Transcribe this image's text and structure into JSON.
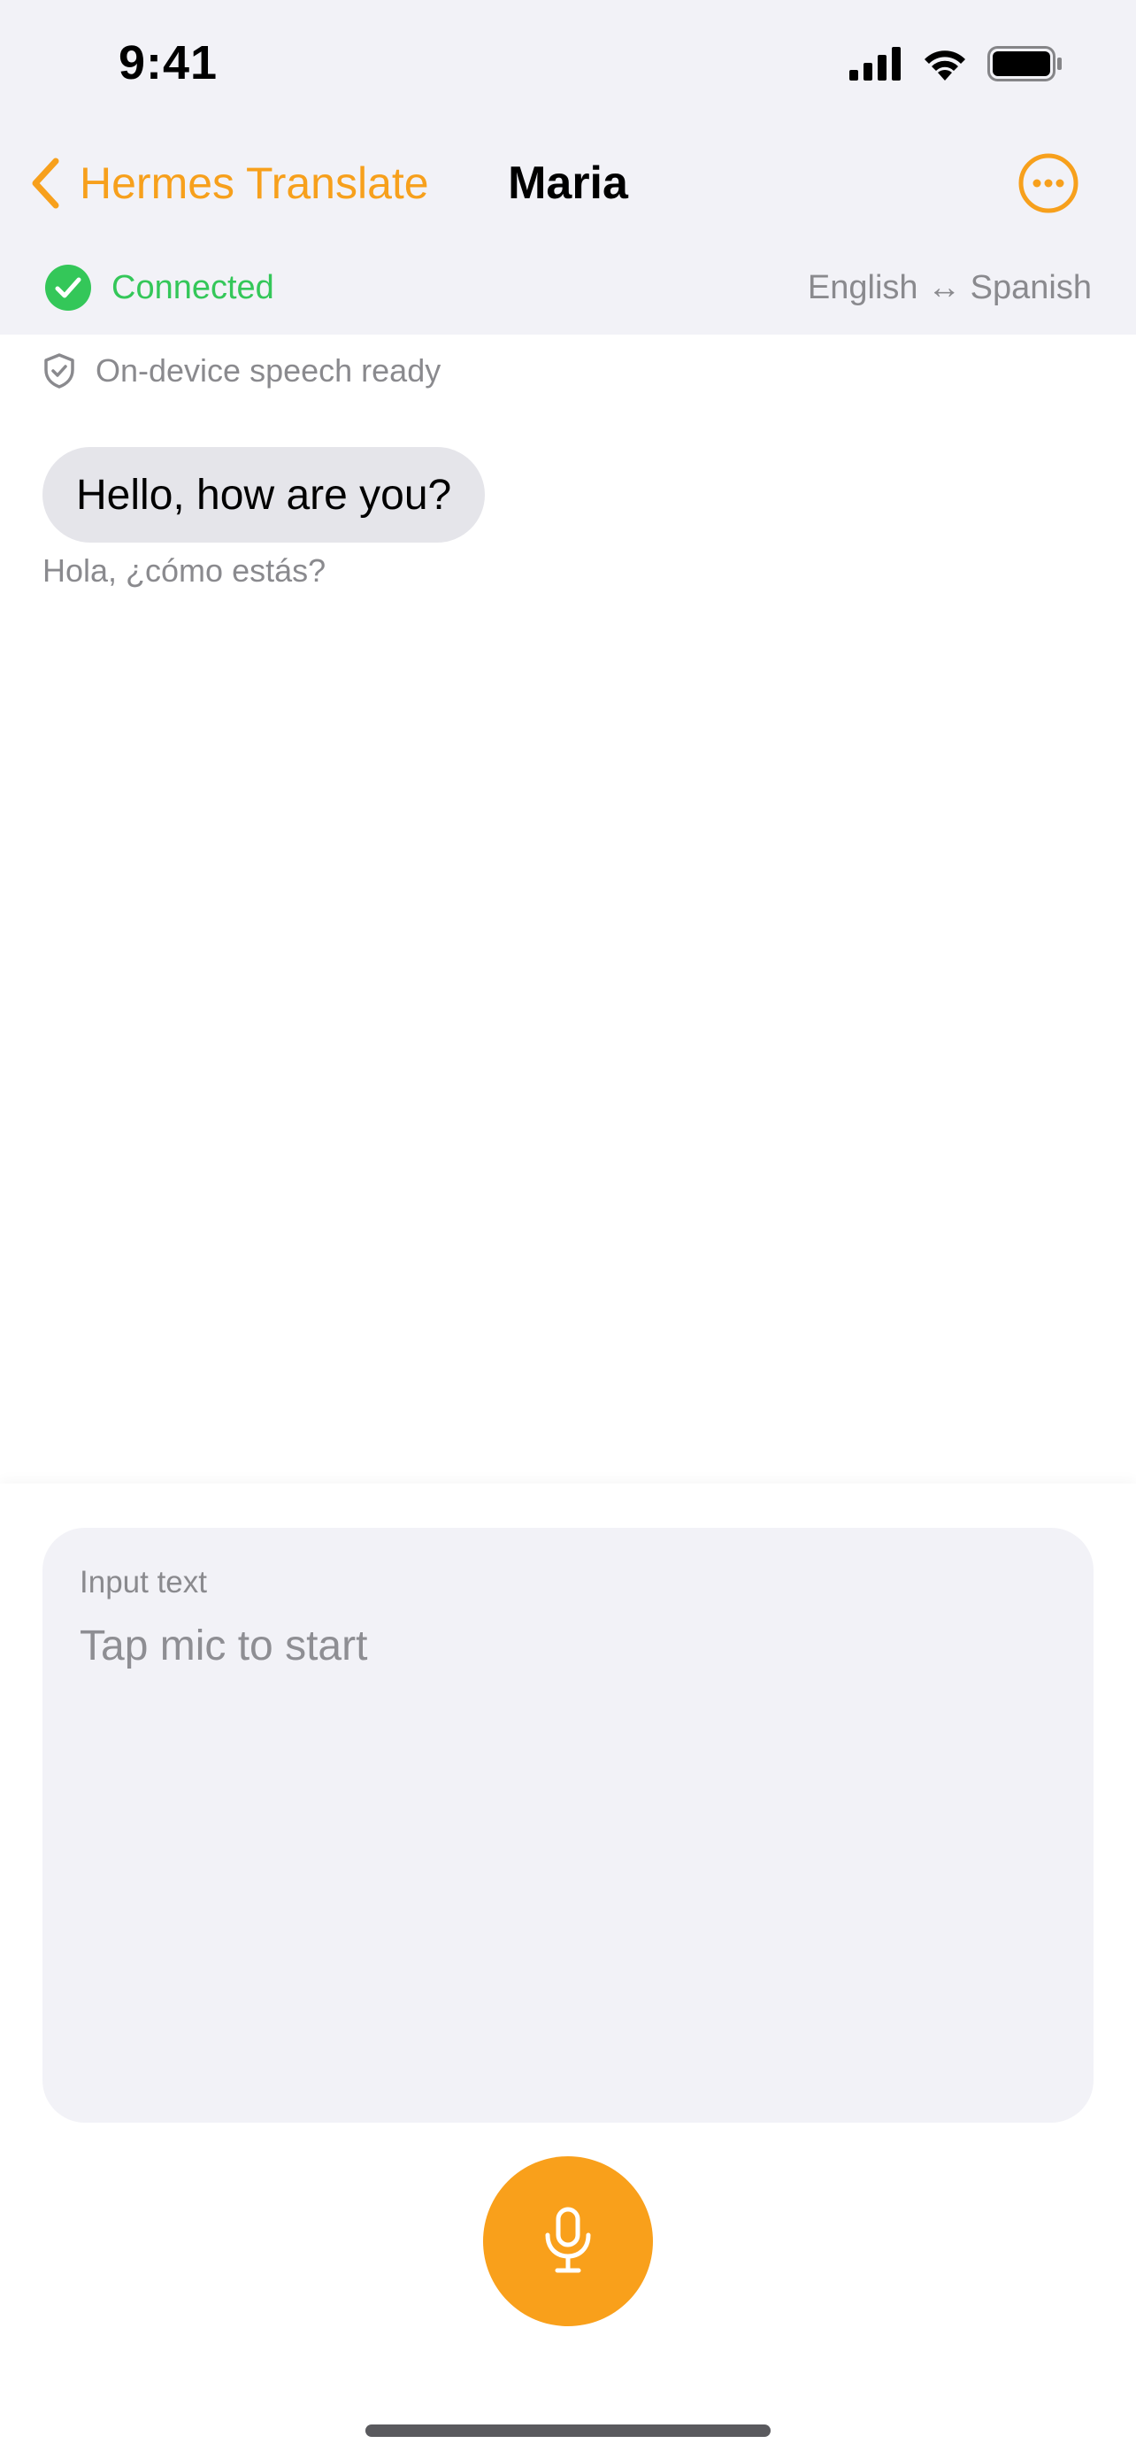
{
  "status_bar": {
    "time": "9:41",
    "icons": [
      "cellular-signal-icon",
      "wifi-icon",
      "battery-icon"
    ]
  },
  "nav": {
    "back_label": "Hermes Translate",
    "title": "Maria",
    "more_icon": "ellipsis-circle-icon"
  },
  "connection": {
    "status": "Connected",
    "language_pair": "English ↔ Spanish",
    "status_icon": "checkmark-circle-icon"
  },
  "speech_status": {
    "label": "On-device speech ready",
    "icon": "shield-check-icon"
  },
  "messages": [
    {
      "text": "Hello, how are you?",
      "translation": "Hola, ¿cómo estás?"
    }
  ],
  "input": {
    "caption": "Input text",
    "placeholder": "Tap mic to start",
    "value": ""
  },
  "mic": {
    "icon": "microphone-icon"
  },
  "colors": {
    "accent": "#f7a01c",
    "connected": "#34c759",
    "secondary_text": "#8a8a8e",
    "bubble": "#e5e5ea",
    "panel": "#f2f2f7"
  }
}
